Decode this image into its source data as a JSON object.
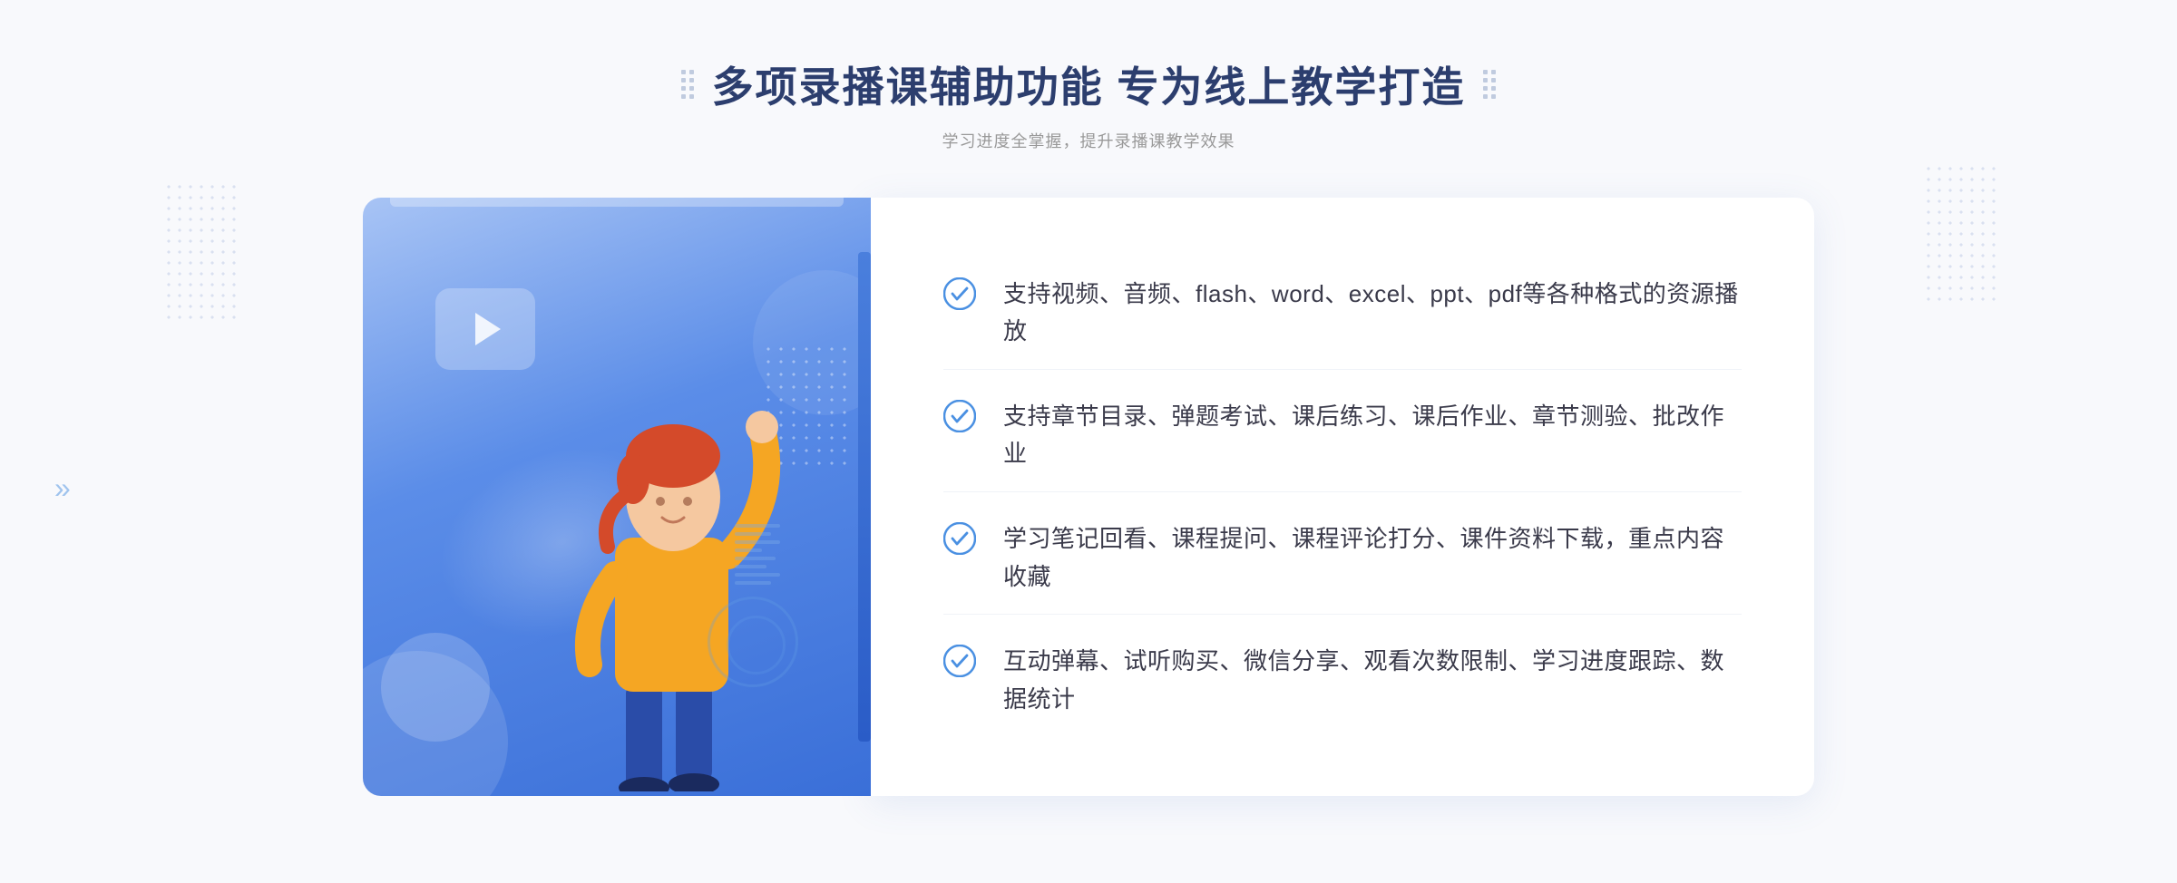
{
  "header": {
    "title": "多项录播课辅助功能 专为线上教学打造",
    "subtitle": "学习进度全掌握，提升录播课教学效果"
  },
  "features": [
    {
      "id": 1,
      "text": "支持视频、音频、flash、word、excel、ppt、pdf等各种格式的资源播放"
    },
    {
      "id": 2,
      "text": "支持章节目录、弹题考试、课后练习、课后作业、章节测验、批改作业"
    },
    {
      "id": 3,
      "text": "学习笔记回看、课程提问、课程评论打分、课件资料下载，重点内容收藏"
    },
    {
      "id": 4,
      "text": "互动弹幕、试听购买、微信分享、观看次数限制、学习进度跟踪、数据统计"
    }
  ],
  "icons": {
    "check": "check-circle",
    "play": "play",
    "arrow_right": "»"
  },
  "colors": {
    "primary": "#4a7fdd",
    "title": "#2c3e6e",
    "text": "#3a3a4a",
    "subtitle": "#999999",
    "check": "#4a90e2",
    "panel_bg": "#ffffff"
  }
}
